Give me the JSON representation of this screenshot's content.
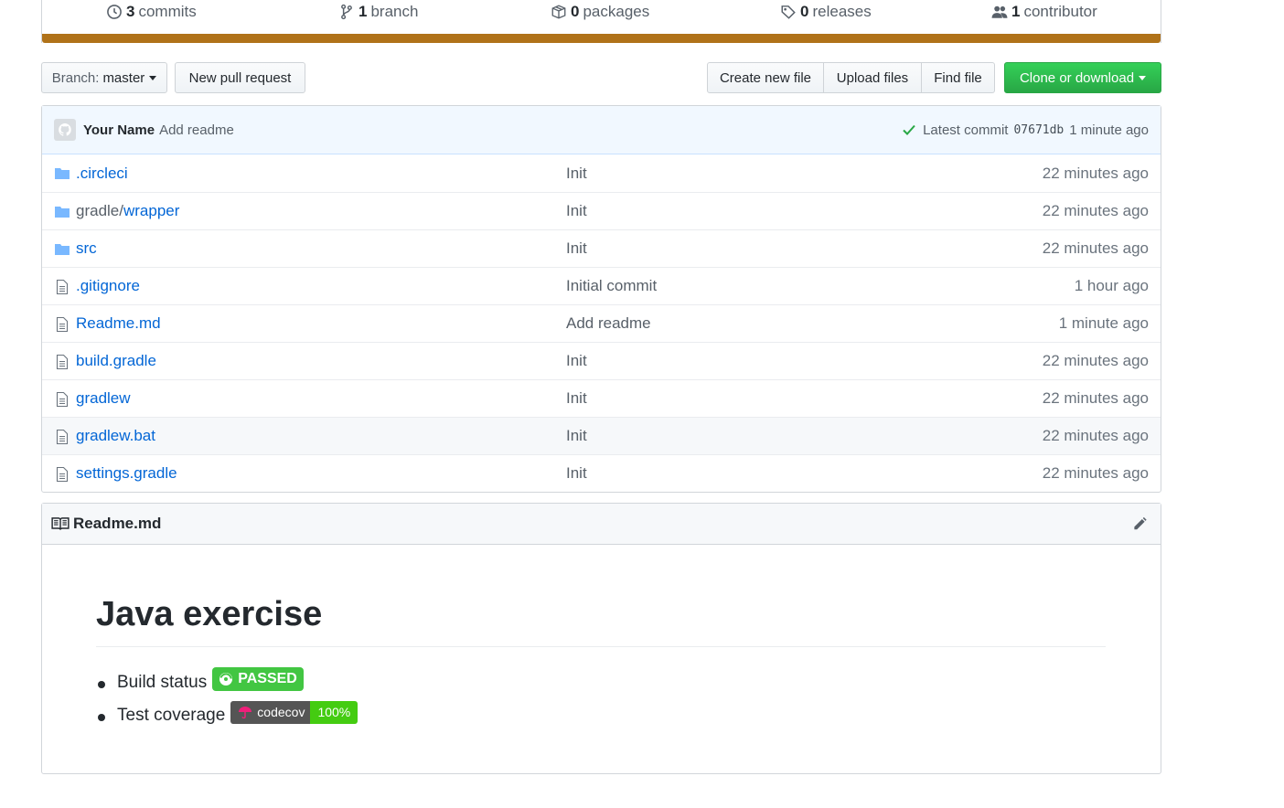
{
  "summary": {
    "commits_count": "3",
    "commits_label": "commits",
    "branch_count": "1",
    "branch_label": "branch",
    "packages_count": "0",
    "packages_label": "packages",
    "releases_count": "0",
    "releases_label": "releases",
    "contributor_count": "1",
    "contributor_label": "contributor",
    "language_color": "#b07219"
  },
  "toolbar": {
    "branch_prefix": "Branch:",
    "branch_name": "master",
    "new_pr": "New pull request",
    "create_file": "Create new file",
    "upload_files": "Upload files",
    "find_file": "Find file",
    "clone": "Clone or download"
  },
  "commit": {
    "author": "Your Name",
    "message": "Add readme",
    "latest_label": "Latest commit",
    "sha": "07671db",
    "age": "1 minute ago"
  },
  "files": [
    {
      "type": "folder",
      "name_prefix": "",
      "name": ".circleci",
      "message": "Init",
      "age": "22 minutes ago"
    },
    {
      "type": "folder",
      "name_prefix": "gradle/",
      "name": "wrapper",
      "message": "Init",
      "age": "22 minutes ago"
    },
    {
      "type": "folder",
      "name_prefix": "",
      "name": "src",
      "message": "Init",
      "age": "22 minutes ago"
    },
    {
      "type": "file",
      "name_prefix": "",
      "name": ".gitignore",
      "message": "Initial commit",
      "age": "1 hour ago"
    },
    {
      "type": "file",
      "name_prefix": "",
      "name": "Readme.md",
      "message": "Add readme",
      "age": "1 minute ago"
    },
    {
      "type": "file",
      "name_prefix": "",
      "name": "build.gradle",
      "message": "Init",
      "age": "22 minutes ago"
    },
    {
      "type": "file",
      "name_prefix": "",
      "name": "gradlew",
      "message": "Init",
      "age": "22 minutes ago"
    },
    {
      "type": "file",
      "name_prefix": "",
      "name": "gradlew.bat",
      "message": "Init",
      "age": "22 minutes ago"
    },
    {
      "type": "file",
      "name_prefix": "",
      "name": "settings.gradle",
      "message": "Init",
      "age": "22 minutes ago"
    }
  ],
  "readme": {
    "filename": "Readme.md",
    "title": "Java exercise",
    "build_label": "Build status",
    "build_badge": "PASSED",
    "coverage_label": "Test coverage",
    "coverage_badge_left": "codecov",
    "coverage_badge_right": "100%"
  }
}
